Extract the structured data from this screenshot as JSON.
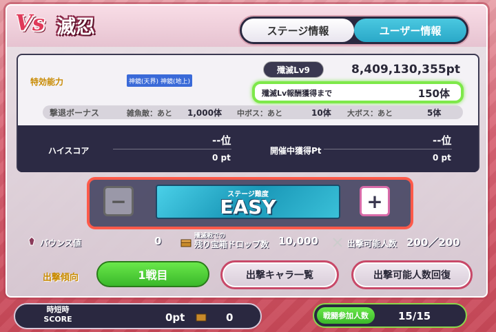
{
  "header": {
    "vs_logo": "Vs",
    "title": "滅忍",
    "tabs": [
      {
        "label": "ステージ情報"
      },
      {
        "label": "ユーザー情報"
      }
    ]
  },
  "info": {
    "tokko_label": "特効能力",
    "chips": [
      "神鏡(天界)",
      "神鏡(地上)"
    ],
    "lv_label": "殲滅Lv9",
    "total_pt": "8,409,130,355pt",
    "reward_label": "殲滅Lv報酬獲得まで",
    "reward_value": "150体"
  },
  "bonus": {
    "title": "撃退ボーナス",
    "items": [
      {
        "label": "雑魚敵：あと",
        "value": "1,000体"
      },
      {
        "label": "中ボス：あと",
        "value": "10体"
      },
      {
        "label": "大ボス：あと",
        "value": "5体"
      }
    ]
  },
  "scores": {
    "high_score_label": "ハイスコア",
    "high_score_rank": "--位",
    "high_score_pt": "0 pt",
    "event_pt_label": "開催中獲得Pt",
    "event_pt_rank": "--位",
    "event_pt_pt": "0 pt"
  },
  "difficulty": {
    "sub": "ステージ難度",
    "value": "EASY",
    "minus": "−",
    "plus": "+"
  },
  "stats": {
    "bounce_label": "バウンス値",
    "bounce_value": "0",
    "chest_label_1": "殲滅戦での",
    "chest_label_2": "残り宝箱ドロップ数",
    "chest_value": "10,000",
    "sortie_label": "出撃可能人数",
    "sortie_value": "200／200"
  },
  "actions": {
    "tendency_label": "出撃傾向",
    "tendency_value": "1戦目",
    "character_list": "出撃キャラ一覧",
    "recover": "出撃可能人数回復"
  },
  "footer": {
    "time_label_1": "時短時",
    "time_label_2": "SCORE",
    "time_pt": "0pt",
    "time_count": "0",
    "participants_label": "戦闘参加人数",
    "participants_value": "15/15"
  },
  "colors": {
    "accent_green": "#7ee84a",
    "accent_red": "#ff5a4a",
    "tab_active": "#2aa8c8",
    "panel_dark": "#2c2a44"
  }
}
